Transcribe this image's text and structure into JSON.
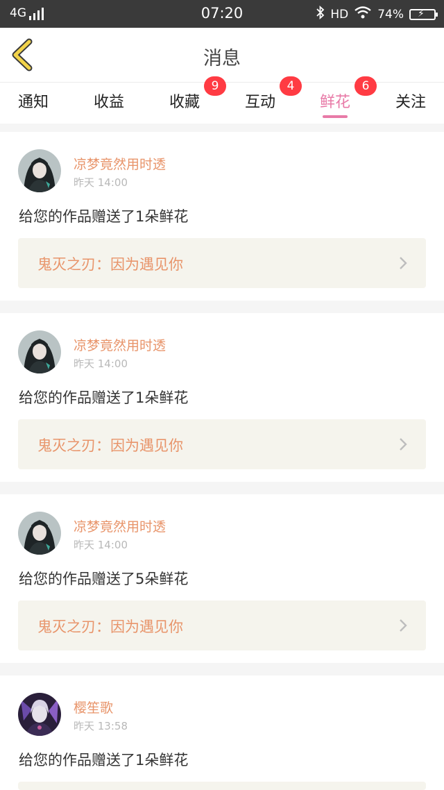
{
  "status_bar": {
    "network": "4G",
    "time": "07:20",
    "hd": "HD",
    "battery": "74%"
  },
  "header": {
    "title": "消息"
  },
  "tabs": [
    {
      "label": "通知",
      "badge": ""
    },
    {
      "label": "收益",
      "badge": ""
    },
    {
      "label": "收藏",
      "badge": "9"
    },
    {
      "label": "互动",
      "badge": "4"
    },
    {
      "label": "鲜花",
      "badge": "6",
      "active": true
    },
    {
      "label": "关注",
      "badge": ""
    }
  ],
  "messages": [
    {
      "user": "凉梦竟然用时透",
      "time": "昨天 14:00",
      "text": "给您的作品赠送了1朵鲜花",
      "work": "鬼灭之刃：因为遇见你"
    },
    {
      "user": "凉梦竟然用时透",
      "time": "昨天 14:00",
      "text": "给您的作品赠送了1朵鲜花",
      "work": "鬼灭之刃：因为遇见你"
    },
    {
      "user": "凉梦竟然用时透",
      "time": "昨天 14:00",
      "text": "给您的作品赠送了5朵鲜花",
      "work": "鬼灭之刃：因为遇见你"
    },
    {
      "user": "樱笙歌",
      "time": "昨天 13:58",
      "text": "给您的作品赠送了1朵鲜花",
      "work": ""
    }
  ],
  "colors": {
    "accent_pink": "#e87aa7",
    "badge_red": "#ff3b43",
    "username_orange": "#e8946a",
    "back_arrow_yellow": "#f2d34a"
  }
}
